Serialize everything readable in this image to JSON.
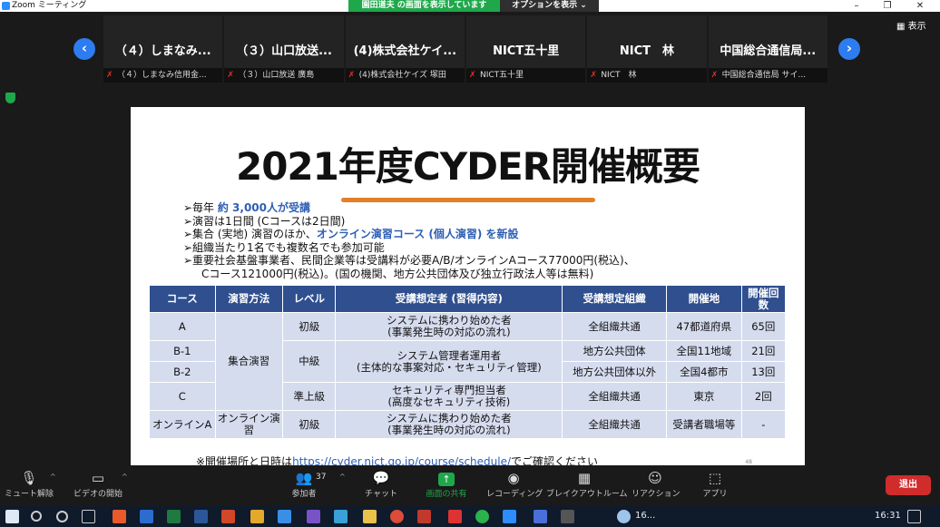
{
  "titlebar": {
    "title": "Zoom ミーティング",
    "share_status": "園田道夫 の画面を表示しています",
    "share_options": "オプションを表示 ⌄",
    "minimize": "–",
    "restore": "❐",
    "close": "✕"
  },
  "view_button": {
    "label": "表示"
  },
  "thumbs": {
    "prev": "‹",
    "next": "›",
    "items": [
      {
        "big": "（４）しまなみ...",
        "label": "（４）しまなみ信用金..."
      },
      {
        "big": "（３）山口放送...",
        "label": "（３）山口放送 廣島"
      },
      {
        "big": "(4)株式会社ケイ...",
        "label": "(4)株式会社ケイズ 塚田"
      },
      {
        "big": "NICT五十里",
        "label": "NICT五十里"
      },
      {
        "big": "NICT　林",
        "label": "NICT　林"
      },
      {
        "big": "中国総合通信局...",
        "label": "中国総合通信局 サイ..."
      }
    ]
  },
  "slide": {
    "title": "2021年度CYDER開催概要",
    "bullets": {
      "b1_pre": "➢毎年 ",
      "b1_hl": "約 3,000人が受講",
      "b2": "➢演習は1日間 (Cコースは2日間)",
      "b3_pre": "➢集合 (実地) 演習のほか、",
      "b3_hl": "オンライン演習コース (個人演習) を新設",
      "b4": "➢組織当たり1名でも複数名でも参加可能",
      "b5_line1": "➢重要社会基盤事業者、民間企業等は受講料が必要A/B/オンラインAコース77000円(税込)、",
      "b5_line2": "Cコース121000円(税込)。(国の機関、地方公共団体及び独立行政法人等は無料)"
    },
    "table": {
      "headers": [
        "コース",
        "演習方法",
        "レベル",
        "受講想定者 (習得内容)",
        "受講想定組織",
        "開催地",
        "開催回数"
      ],
      "rows": {
        "A": {
          "course": "A",
          "method": "集合演習",
          "level": "初級",
          "target1": "システムに携わり始めた者",
          "target2": "(事業発生時の対応の流れ)",
          "org": "全組織共通",
          "place": "47都道府県",
          "count": "65回"
        },
        "B1": {
          "course": "B-1",
          "level": "中級",
          "target1": "システム管理者運用者",
          "target2": "(主体的な事案対応・セキュリティ管理)",
          "org": "地方公共団体",
          "place": "全国11地域",
          "count": "21回"
        },
        "B2": {
          "course": "B-2",
          "org": "地方公共団体以外",
          "place": "全国4都市",
          "count": "13回"
        },
        "C": {
          "course": "C",
          "level": "準上級",
          "target1": "セキュリティ専門担当者",
          "target2": "(高度なセキュリティ技術)",
          "org": "全組織共通",
          "place": "東京",
          "count": "2回"
        },
        "OA": {
          "course": "オンラインA",
          "method": "オンライン演習",
          "level": "初級",
          "target1": "システムに携わり始めた者",
          "target2": "(事業発生時の対応の流れ)",
          "org": "全組織共通",
          "place": "受講者職場等",
          "count": "-"
        }
      }
    },
    "footnote_pre": "※開催場所と日時は",
    "footnote_url": "https://cyder.nict.go.jp/course/schedule/",
    "footnote_post": "でご確認ください",
    "page_number": "48"
  },
  "controls": {
    "unmute": "ミュート解除",
    "start_video": "ビデオの開始",
    "participants": "参加者",
    "participant_count": "37",
    "chat": "チャット",
    "share_screen": "画面の共有",
    "record": "レコーディング",
    "breakout": "ブレイクアウトルーム",
    "reactions": "リアクション",
    "apps": "アプリ",
    "end": "退出"
  },
  "taskbar": {
    "weather": "16...",
    "time": "16:31"
  }
}
